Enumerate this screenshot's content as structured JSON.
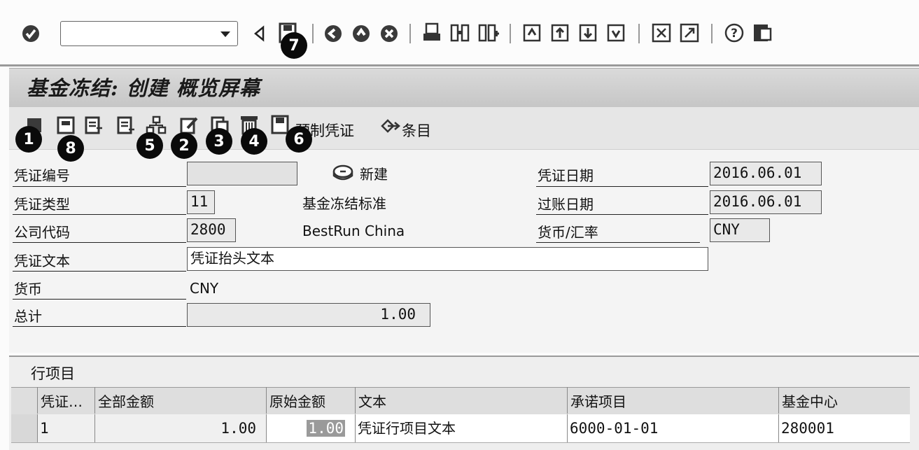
{
  "toolbar": {
    "command_field_value": "",
    "badge_7": "7"
  },
  "title": "基金冻结: 创建 概览屏幕",
  "app_toolbar": {
    "badges": [
      "1",
      "8",
      "5",
      "2",
      "3",
      "4",
      "6"
    ],
    "post_document_label": "预制凭证",
    "entries_label": "条目"
  },
  "header": {
    "doc_number": {
      "label": "凭证编号",
      "value": ""
    },
    "new_label": "新建",
    "doc_type": {
      "label": "凭证类型",
      "value": "11",
      "description": "基金冻结标准"
    },
    "company_code": {
      "label": "公司代码",
      "value": "2800",
      "description": "BestRun China"
    },
    "doc_text": {
      "label": "凭证文本",
      "value": "凭证抬头文本"
    },
    "currency": {
      "label": "货币",
      "value": "CNY"
    },
    "total": {
      "label": "总计",
      "value": "1.00"
    },
    "doc_date": {
      "label": "凭证日期",
      "value": "2016.06.01"
    },
    "posting_date": {
      "label": "过账日期",
      "value": "2016.06.01"
    },
    "currency_rate": {
      "label": "货币/汇率",
      "value": "CNY"
    }
  },
  "items": {
    "title": "行项目",
    "columns": [
      "凭证…",
      "全部金额",
      "原始金额",
      "文本",
      "承诺项目",
      "基金中心"
    ],
    "rows": [
      {
        "item": "1",
        "overall_amount": "1.00",
        "original_amount": "1.00",
        "text": "凭证行项目文本",
        "commitment_item": "6000-01-01",
        "fund_center": "280001"
      }
    ]
  }
}
